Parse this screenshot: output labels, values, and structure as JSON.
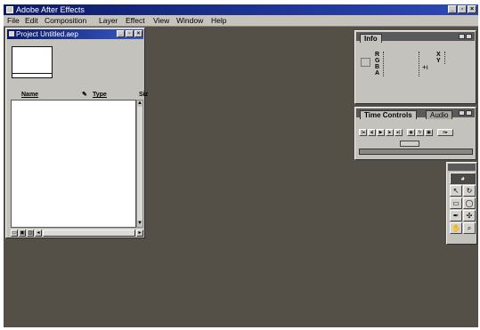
{
  "app": {
    "title": "Adobe After Effects"
  },
  "menu": [
    "File",
    "Edit",
    "Composition",
    "Layer",
    "Effect",
    "View",
    "Window",
    "Help"
  ],
  "window_buttons": {
    "minimize": "_",
    "restore": "▫",
    "close": "×"
  },
  "project": {
    "title": "Project Untitled.aep",
    "columns": {
      "name": "Name",
      "type": "Type",
      "size": "Siz"
    }
  },
  "info": {
    "tab": "Info",
    "channels": [
      "R",
      "G",
      "B",
      "A"
    ],
    "coords": [
      "X",
      "Y"
    ]
  },
  "time_controls": {
    "tab_active": "Time Controls",
    "tab_inactive": "Audio"
  },
  "colors": {
    "workspace": "#545047",
    "titlebar": "#0b1a66",
    "panel": "#c4c2bc"
  }
}
